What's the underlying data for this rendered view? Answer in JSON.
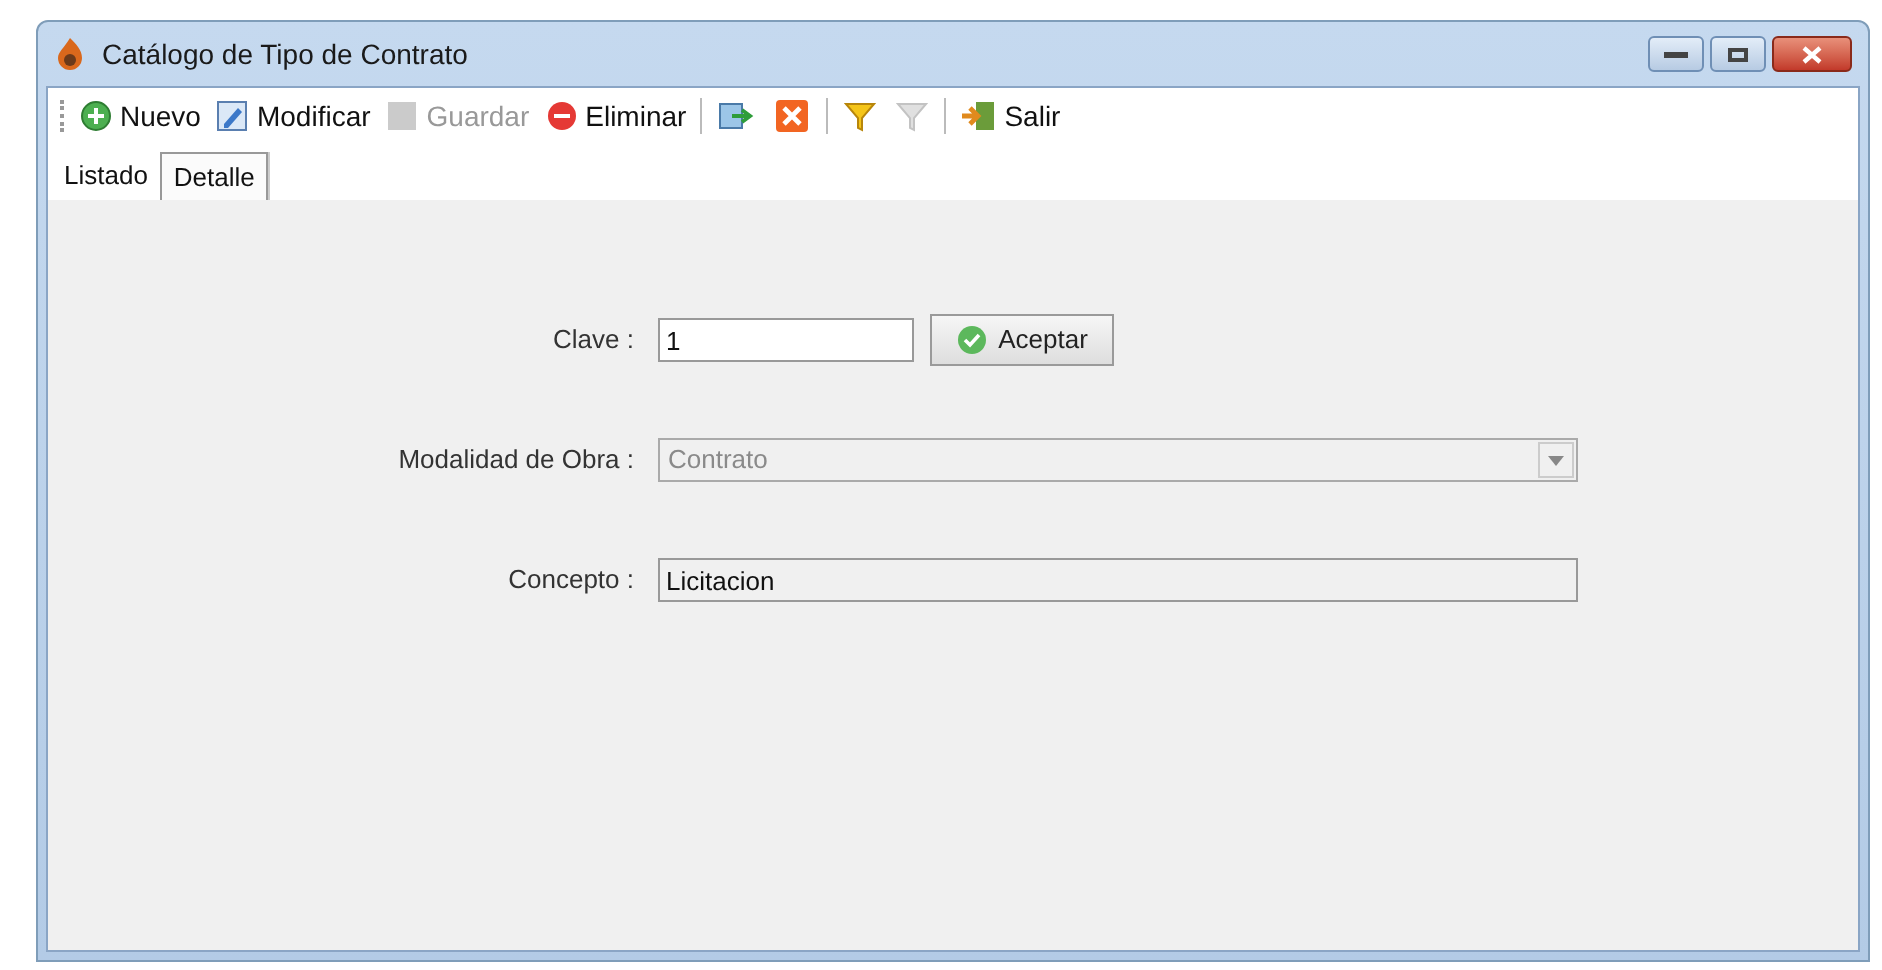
{
  "window": {
    "title": "Catálogo de Tipo de Contrato"
  },
  "toolbar": [
    {
      "kind": "button",
      "label": "Nuevo",
      "disabled": false
    },
    {
      "kind": "button",
      "label": "Modificar",
      "disabled": false
    },
    {
      "kind": "button",
      "label": "Guardar",
      "disabled": true
    },
    {
      "kind": "button",
      "label": "Eliminar",
      "disabled": false
    },
    {
      "kind": "separator"
    },
    {
      "kind": "icon",
      "disabled": false
    },
    {
      "kind": "icon",
      "disabled": false
    },
    {
      "kind": "separator"
    },
    {
      "kind": "icon",
      "disabled": false
    },
    {
      "kind": "icon",
      "disabled": true
    },
    {
      "kind": "separator"
    },
    {
      "kind": "button",
      "label": "Salir",
      "disabled": false
    }
  ],
  "tabs": [
    {
      "label": "Listado",
      "selected": false
    },
    {
      "label": "Detalle",
      "selected": true
    }
  ],
  "form": [
    {
      "kind": "text",
      "label": "Clave :",
      "value": "1",
      "disabled": false,
      "button": "Aceptar"
    },
    {
      "kind": "select",
      "label": "Modalidad de Obra :",
      "value": "Contrato",
      "disabled": true
    },
    {
      "kind": "text",
      "label": "Concepto :",
      "value": "Licitacion",
      "disabled": true
    }
  ]
}
